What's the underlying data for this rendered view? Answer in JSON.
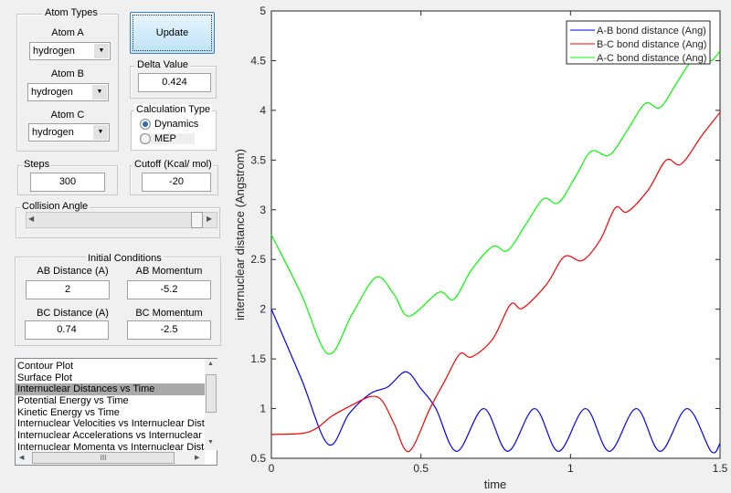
{
  "atom_types": {
    "title": "Atom Types",
    "atoms": [
      {
        "label": "Atom A",
        "value": "hydrogen"
      },
      {
        "label": "Atom B",
        "value": "hydrogen"
      },
      {
        "label": "Atom C",
        "value": "hydrogen"
      }
    ]
  },
  "update_label": "Update",
  "delta": {
    "title": "Delta Value",
    "value": "0.424"
  },
  "calc_type": {
    "title": "Calculation Type",
    "options": [
      {
        "label": "Dynamics",
        "selected": true
      },
      {
        "label": "MEP",
        "selected": false
      }
    ]
  },
  "steps": {
    "title": "Steps",
    "value": "300"
  },
  "cutoff": {
    "title": "Cutoff (Kcal/ mol)",
    "value": "-20"
  },
  "collision": {
    "title": "Collision Angle",
    "slider_fraction": 1.0
  },
  "initial": {
    "title": "Initial Conditions",
    "ab_distance": {
      "label": "AB Distance (A)",
      "value": "2"
    },
    "ab_momentum": {
      "label": "AB Momentum",
      "value": "-5.2"
    },
    "bc_distance": {
      "label": "BC Distance (A)",
      "value": "0.74"
    },
    "bc_momentum": {
      "label": "BC Momentum",
      "value": "-2.5"
    }
  },
  "plot_list": {
    "items": [
      "Contour Plot",
      "Surface Plot",
      "Internuclear Distances vs Time",
      "Potential Energy vs Time",
      "Kinetic Energy vs Time",
      "Internuclear Velocities vs Internuclear Distance",
      "Internuclear Accelerations vs Internuclear Distance",
      "Internuclear Momenta vs Internuclear Distance"
    ],
    "selected": "Internuclear Distances vs Time",
    "hscroll_thumb": "III"
  },
  "chart_data": {
    "type": "line",
    "xlabel": "time",
    "ylabel": "internuclear distance (Angstrom)",
    "xlim": [
      0,
      1.5
    ],
    "ylim": [
      0.5,
      5
    ],
    "xticks": [
      "0",
      "0.5",
      "1",
      "1.5"
    ],
    "yticks": [
      "0.5",
      "1",
      "1.5",
      "2",
      "2.5",
      "3",
      "3.5",
      "4",
      "4.5",
      "5"
    ],
    "grid": false,
    "legend": "top-right",
    "series": [
      {
        "name": "A-B bond distance (Ang)",
        "color": "#0000ff",
        "points": [
          [
            0,
            2
          ],
          [
            0.1,
            1.3
          ],
          [
            0.19,
            0.64
          ],
          [
            0.26,
            0.95
          ],
          [
            0.33,
            1.15
          ],
          [
            0.39,
            1.22
          ],
          [
            0.45,
            1.37
          ],
          [
            0.5,
            1.2
          ],
          [
            0.55,
            1.0
          ],
          [
            0.62,
            0.57
          ],
          [
            0.71,
            1.0
          ],
          [
            0.79,
            0.57
          ],
          [
            0.88,
            1.0
          ],
          [
            0.96,
            0.57
          ],
          [
            1.05,
            1.0
          ],
          [
            1.13,
            0.57
          ],
          [
            1.22,
            1.0
          ],
          [
            1.3,
            0.57
          ],
          [
            1.39,
            1.0
          ],
          [
            1.47,
            0.57
          ],
          [
            1.5,
            0.65
          ]
        ]
      },
      {
        "name": "B-C bond distance (Ang)",
        "color": "#ff0000",
        "points": [
          [
            0,
            0.74
          ],
          [
            0.1,
            0.75
          ],
          [
            0.15,
            0.8
          ],
          [
            0.2,
            0.92
          ],
          [
            0.26,
            1.02
          ],
          [
            0.33,
            1.12
          ],
          [
            0.37,
            1.08
          ],
          [
            0.41,
            0.85
          ],
          [
            0.46,
            0.57
          ],
          [
            0.53,
            1.0
          ],
          [
            0.58,
            1.28
          ],
          [
            0.63,
            1.55
          ],
          [
            0.67,
            1.52
          ],
          [
            0.74,
            1.7
          ],
          [
            0.8,
            2.05
          ],
          [
            0.84,
            2.01
          ],
          [
            0.92,
            2.25
          ],
          [
            0.98,
            2.53
          ],
          [
            1.04,
            2.49
          ],
          [
            1.1,
            2.7
          ],
          [
            1.15,
            3.02
          ],
          [
            1.19,
            2.98
          ],
          [
            1.26,
            3.2
          ],
          [
            1.32,
            3.5
          ],
          [
            1.37,
            3.46
          ],
          [
            1.44,
            3.75
          ],
          [
            1.5,
            3.98
          ]
        ]
      },
      {
        "name": "A-C bond distance (Ang)",
        "color": "#00ff00",
        "points": [
          [
            0,
            2.75
          ],
          [
            0.1,
            2.15
          ],
          [
            0.19,
            1.55
          ],
          [
            0.27,
            1.95
          ],
          [
            0.35,
            2.32
          ],
          [
            0.41,
            2.15
          ],
          [
            0.46,
            1.93
          ],
          [
            0.56,
            2.17
          ],
          [
            0.61,
            2.1
          ],
          [
            0.67,
            2.4
          ],
          [
            0.74,
            2.63
          ],
          [
            0.79,
            2.59
          ],
          [
            0.85,
            2.85
          ],
          [
            0.91,
            3.11
          ],
          [
            0.96,
            3.07
          ],
          [
            1.02,
            3.35
          ],
          [
            1.07,
            3.59
          ],
          [
            1.13,
            3.55
          ],
          [
            1.19,
            3.8
          ],
          [
            1.25,
            4.07
          ],
          [
            1.3,
            4.03
          ],
          [
            1.36,
            4.3
          ],
          [
            1.42,
            4.55
          ],
          [
            1.47,
            4.5
          ],
          [
            1.5,
            4.6
          ]
        ]
      }
    ]
  }
}
